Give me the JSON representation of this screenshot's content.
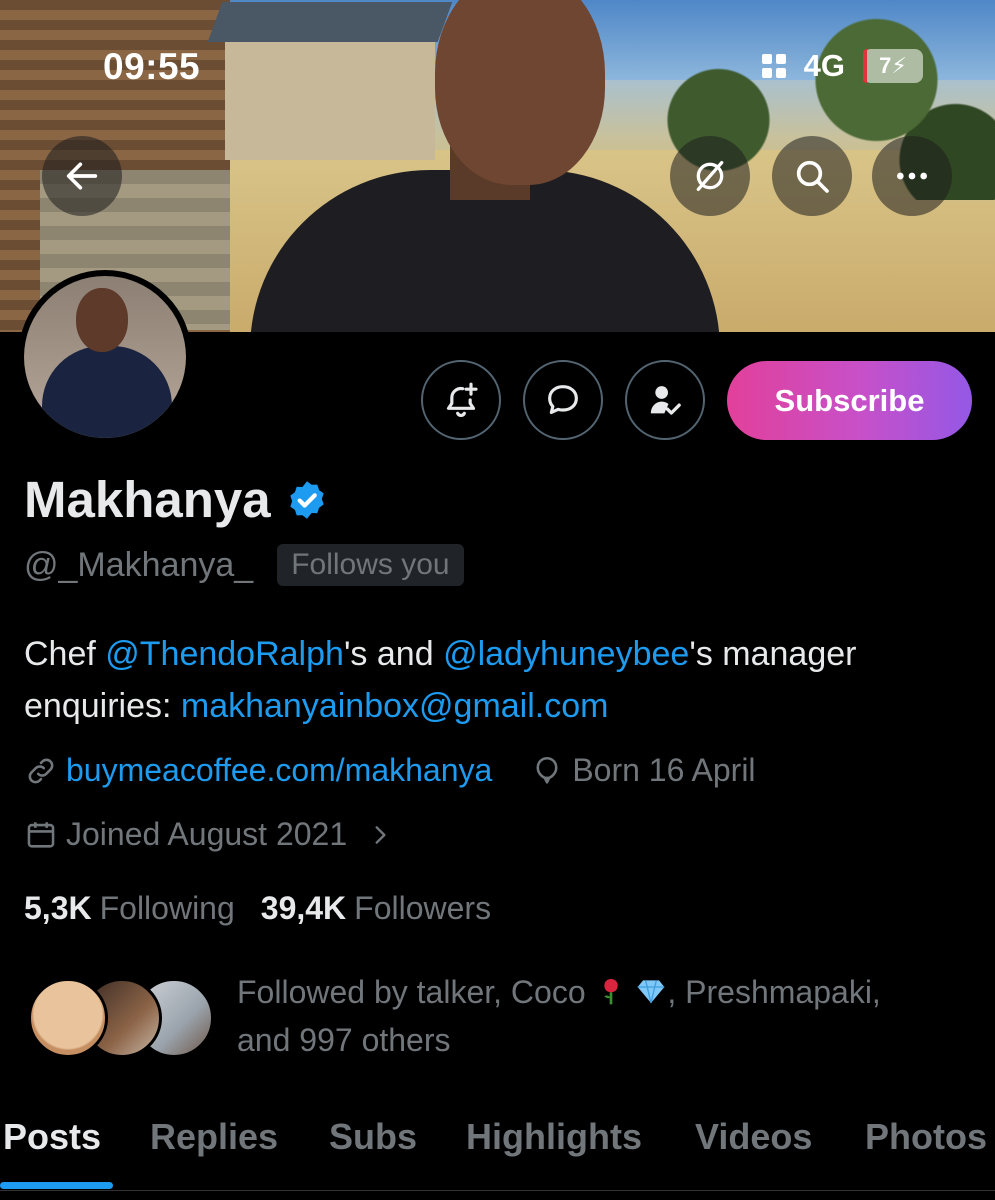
{
  "status_bar": {
    "time": "09:55",
    "network": "4G",
    "battery": "7"
  },
  "banner_buttons": {
    "back": "arrow-left-icon",
    "grok": "grok-icon",
    "search": "search-icon",
    "more": "more-icon"
  },
  "actions": {
    "subscribe_label": "Subscribe"
  },
  "profile": {
    "display_name": "Makhanya",
    "handle": "@_Makhanya_",
    "follows_you": "Follows you",
    "bio": {
      "part1": "Chef ",
      "mention1": "@ThendoRalph",
      "part2": "'s and ",
      "mention2": "@ladyhuneybee",
      "part3": "'s manager",
      "part4": "enquiries: ",
      "email": "makhanyainbox@gmail.com"
    },
    "website": "buymeacoffee.com/makhanya",
    "birthday": "Born 16 April",
    "joined": "Joined August 2021"
  },
  "stats": {
    "following_count": "5,3K",
    "following_label": "Following",
    "followers_count": "39,4K",
    "followers_label": "Followers"
  },
  "followed_by": {
    "prefix": "Followed by talker, Coco ",
    "suffix": ", Preshmapaki,",
    "line2": "and 997 others"
  },
  "tabs": [
    {
      "label": "Posts",
      "active": true
    },
    {
      "label": "Replies",
      "active": false
    },
    {
      "label": "Subs",
      "active": false
    },
    {
      "label": "Highlights",
      "active": false
    },
    {
      "label": "Videos",
      "active": false
    },
    {
      "label": "Photos",
      "active": false
    }
  ],
  "colors": {
    "accent": "#1d9bf0",
    "muted": "#71767b",
    "subscribe_start": "#e2409a",
    "subscribe_end": "#9458e6"
  }
}
